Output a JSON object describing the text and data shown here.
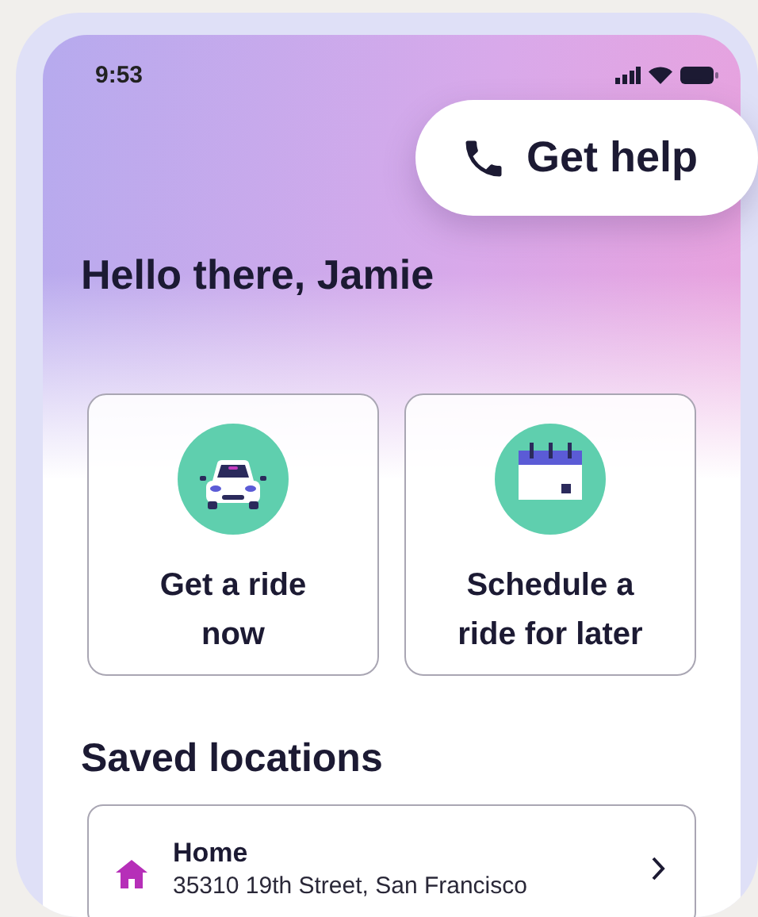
{
  "status_bar": {
    "time": "9:53"
  },
  "help_button": {
    "label": "Get help"
  },
  "greeting": "Hello there, Jamie",
  "actions": [
    {
      "kind": "ride",
      "label": "Get a ride now"
    },
    {
      "kind": "schedule",
      "label": "Schedule a ride for later"
    }
  ],
  "saved_locations": {
    "title": "Saved locations",
    "items": [
      {
        "kind": "home",
        "name": "Home",
        "address": "35310 19th Street, San Francisco"
      }
    ]
  }
}
